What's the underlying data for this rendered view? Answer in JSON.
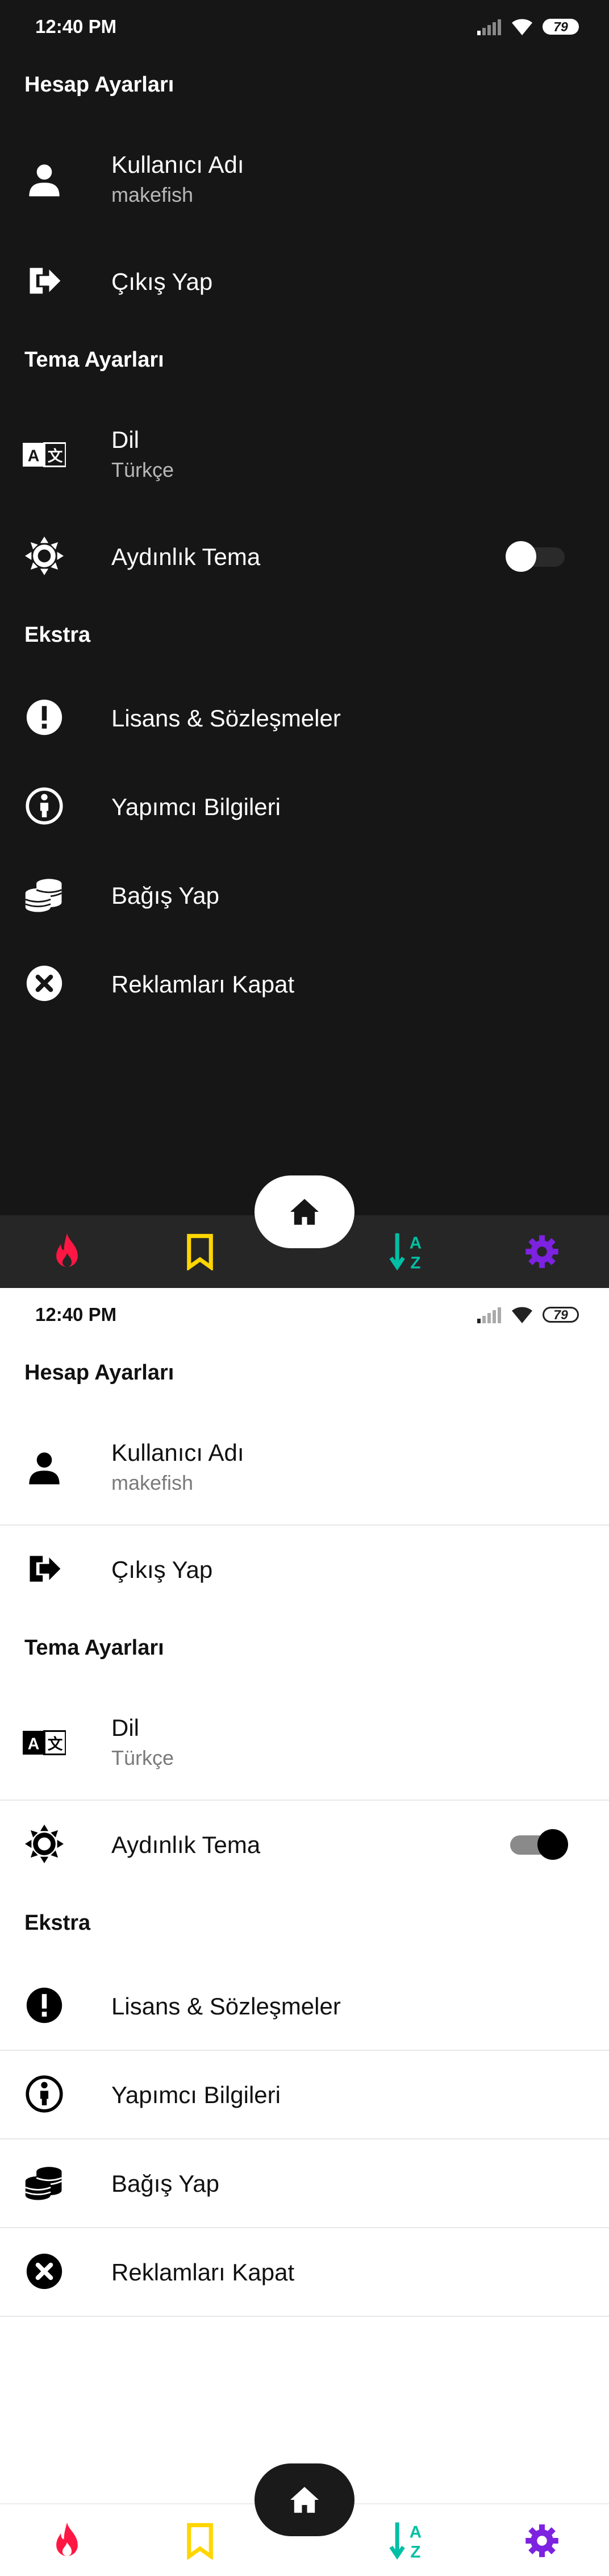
{
  "screens": [
    {
      "theme": "dark",
      "status": {
        "time": "12:40 PM",
        "battery": "79"
      },
      "sections": {
        "account": "Hesap Ayarları",
        "theme": "Tema Ayarları",
        "extra": "Ekstra"
      },
      "items": {
        "username": {
          "label": "Kullanıcı Adı",
          "value": "makefish"
        },
        "logout": {
          "label": "Çıkış Yap"
        },
        "language": {
          "label": "Dil",
          "value": "Türkçe"
        },
        "light_theme": {
          "label": "Aydınlık Tema",
          "enabled": false
        },
        "license": {
          "label": "Lisans & Sözleşmeler"
        },
        "developer": {
          "label": "Yapımcı Bilgileri"
        },
        "donate": {
          "label": "Bağış Yap"
        },
        "ads": {
          "label": "Reklamları Kapat"
        }
      },
      "nav": {
        "icons": [
          "fire-icon",
          "bookmark-icon",
          "home-icon",
          "sort-az-icon",
          "gear-icon"
        ],
        "colors": {
          "fire": "#ff1744",
          "bookmark": "#ffd600",
          "sort": "#00bfa5",
          "gear": "#7c22e0"
        }
      }
    },
    {
      "theme": "light",
      "status": {
        "time": "12:40 PM",
        "battery": "79"
      },
      "sections": {
        "account": "Hesap Ayarları",
        "theme": "Tema Ayarları",
        "extra": "Ekstra"
      },
      "items": {
        "username": {
          "label": "Kullanıcı Adı",
          "value": "makefish"
        },
        "logout": {
          "label": "Çıkış Yap"
        },
        "language": {
          "label": "Dil",
          "value": "Türkçe"
        },
        "light_theme": {
          "label": "Aydınlık Tema",
          "enabled": true
        },
        "license": {
          "label": "Lisans & Sözleşmeler"
        },
        "developer": {
          "label": "Yapımcı Bilgileri"
        },
        "donate": {
          "label": "Bağış Yap"
        },
        "ads": {
          "label": "Reklamları Kapat"
        }
      },
      "nav": {
        "icons": [
          "fire-icon",
          "bookmark-icon",
          "home-icon",
          "sort-az-icon",
          "gear-icon"
        ],
        "colors": {
          "fire": "#ff1744",
          "bookmark": "#ffd600",
          "sort": "#00bfa5",
          "gear": "#7c22e0"
        }
      }
    }
  ]
}
